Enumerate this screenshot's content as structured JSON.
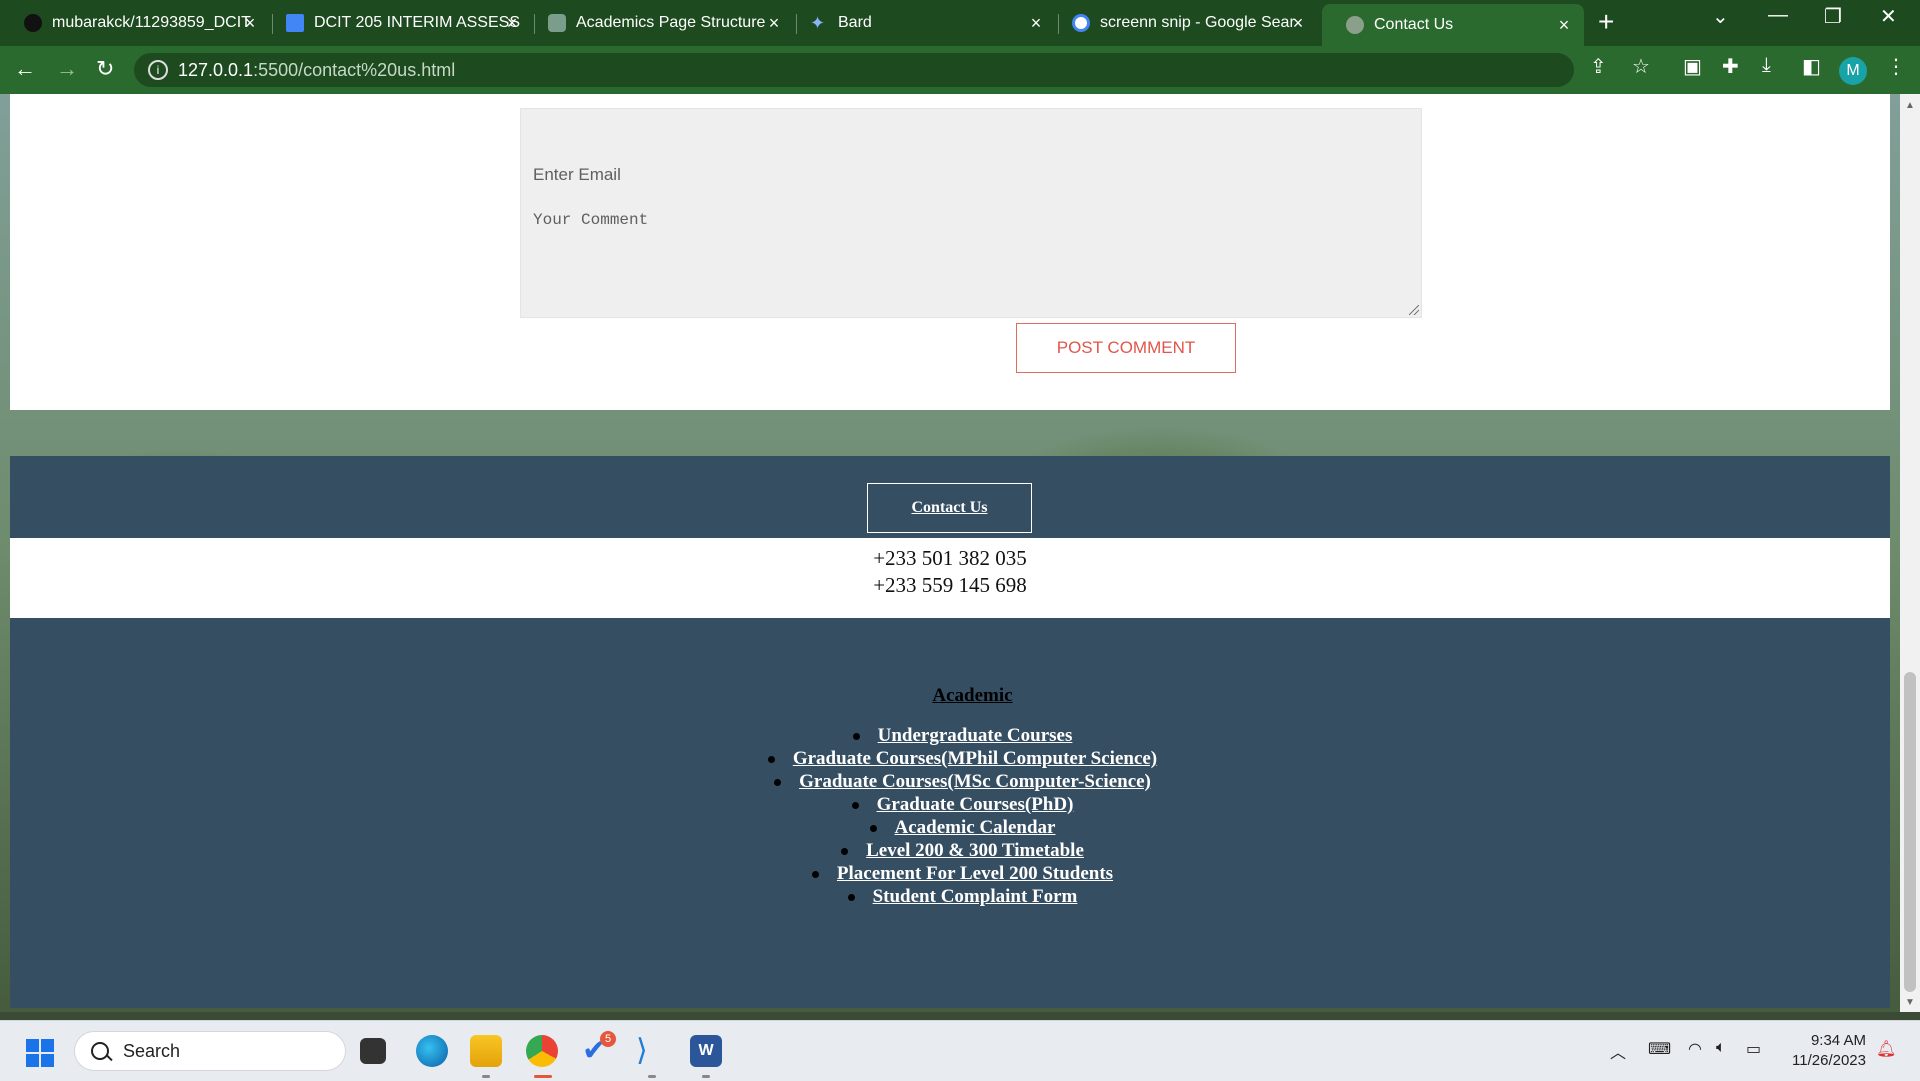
{
  "browser": {
    "tabs": [
      {
        "label": "mubarakck/11293859_DCIT",
        "icon": "github-icon",
        "active": false
      },
      {
        "label": "DCIT 205 INTERIM ASSESS",
        "icon": "google-docs-icon",
        "active": false
      },
      {
        "label": "Academics Page Structure",
        "icon": "chatgpt-icon",
        "active": false
      },
      {
        "label": "Bard",
        "icon": "bard-icon",
        "active": false
      },
      {
        "label": "screenn snip - Google Sear",
        "icon": "google-icon",
        "active": false
      },
      {
        "label": "Contact Us",
        "icon": "globe-icon",
        "active": true
      }
    ],
    "new_tab": "+",
    "tab_close": "×",
    "url_host": "127.0.0.1",
    "url_path": ":5500/contact%20us.html",
    "profile_initial": "M"
  },
  "page": {
    "email_placeholder": "Enter Email",
    "comment_placeholder": "Your Comment",
    "post_button": "POST COMMENT",
    "contact_button": "Contact Us",
    "phones": [
      "+233 501 382 035",
      "+233 559 145 698"
    ],
    "footer": {
      "heading": "Academic",
      "links": [
        "Undergraduate Courses",
        "Graduate Courses(MPhil Computer Science)",
        "Graduate Courses(MSc Computer-Science)",
        "Graduate Courses(PhD)",
        "Academic Calendar",
        "Level 200 & 300 Timetable",
        "Placement For Level 200 Students",
        "Student Complaint Form"
      ]
    }
  },
  "taskbar": {
    "search_label": "Search",
    "badge_count": "5",
    "time": "9:34 AM",
    "date": "11/26/2023"
  },
  "colors": {
    "chrome_dark": "#1d4a1f",
    "chrome_toolbar": "#2b6a2e",
    "footer_bg": "#364e62",
    "post_button_accent": "#e0564a"
  }
}
